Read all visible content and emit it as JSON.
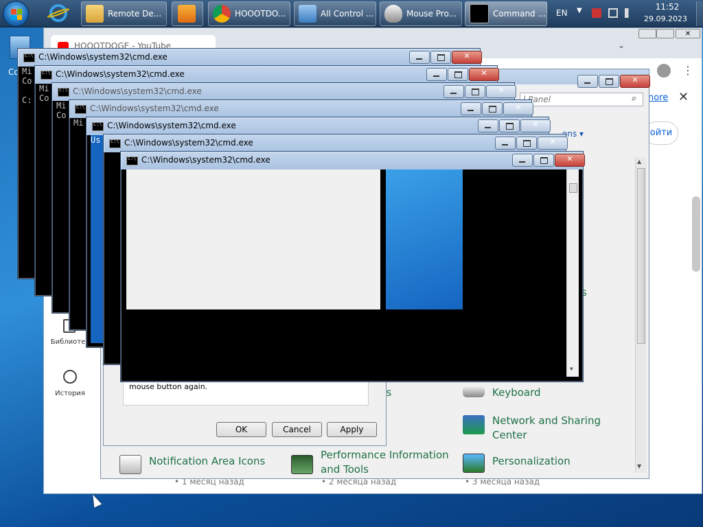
{
  "taskbar": {
    "buttons": [
      {
        "label": "Remote De..."
      },
      {
        "label": "HOOOTDO..."
      },
      {
        "label": "All Control ..."
      },
      {
        "label": "Mouse Pro..."
      },
      {
        "label": "Command ..."
      }
    ],
    "language": "EN",
    "time": "11:52",
    "date": "29.09.2023"
  },
  "desktop": {
    "icon_label": "Co"
  },
  "browser": {
    "tab_title": "HOOOTDOGE - YouTube",
    "more_link": "nore",
    "signin_label": "ойти",
    "sidebar": {
      "library": "Библиотек",
      "history": "История"
    },
    "timestamps": [
      "• 1 месяц назад",
      "• 2 месяца назад",
      "• 3 месяца назад"
    ]
  },
  "control_panel": {
    "search_placeholder": "l Panel",
    "view_label": "ons",
    "side_text": "s",
    "items": [
      {
        "label": "Keyboard"
      },
      {
        "label": "Network and Sharing Center"
      },
      {
        "label": "Notification Area Icons"
      },
      {
        "label": "Performance Information and Tools"
      },
      {
        "label": "Personalization"
      }
    ],
    "partial_item": "ns"
  },
  "mouse_dialog": {
    "text": "mouse button again.",
    "ok": "OK",
    "cancel": "Cancel",
    "apply": "Apply"
  },
  "cmd": {
    "title": "C:\\Windows\\system32\\cmd.exe",
    "lines": [
      "Mi",
      "Co",
      "",
      "C:"
    ],
    "partial_text": "Us"
  },
  "colors": {
    "accent_link": "#1e7145",
    "close_red": "#c6403a"
  }
}
